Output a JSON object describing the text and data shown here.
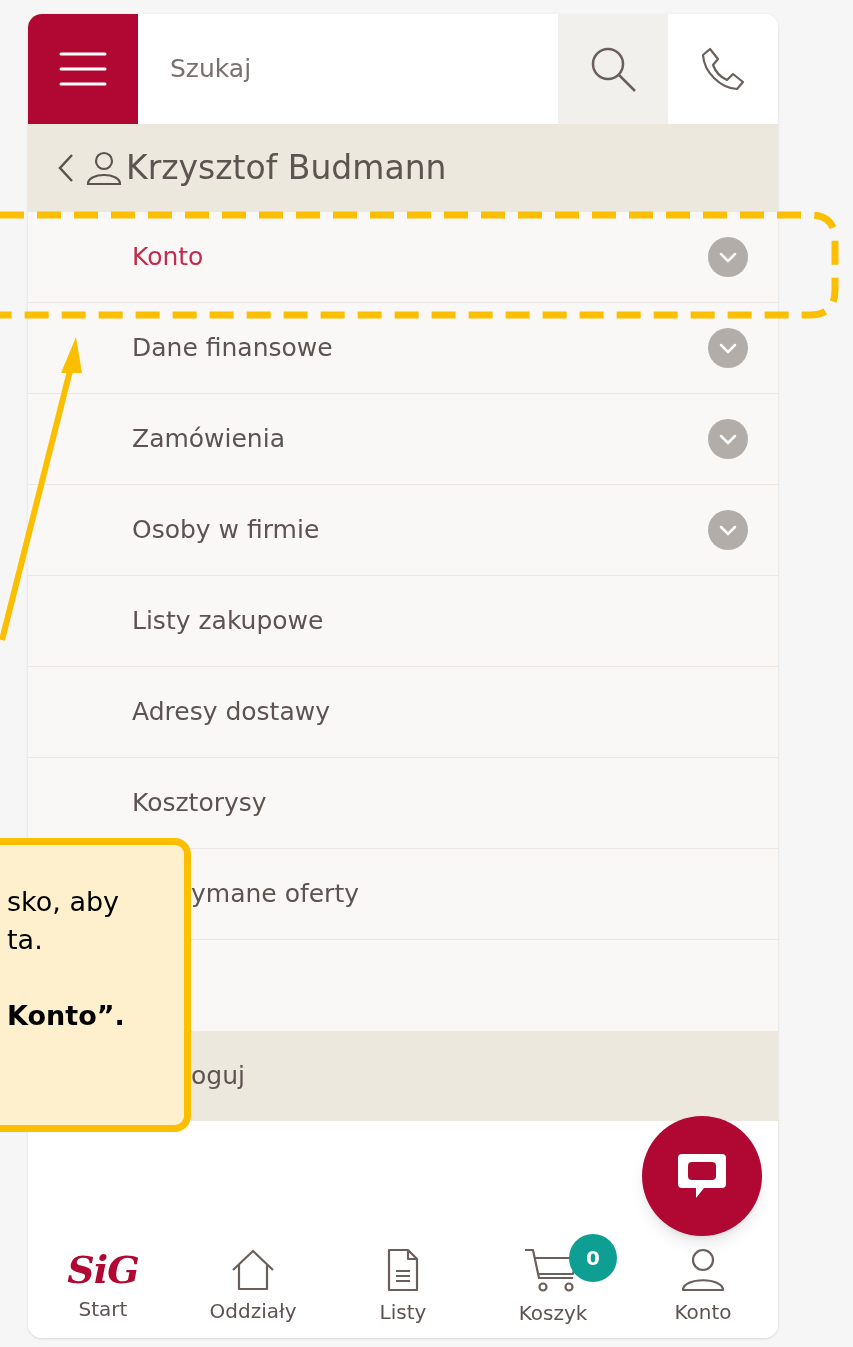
{
  "header": {
    "search": {
      "placeholder": "Szukaj"
    }
  },
  "profile": {
    "name": "Krzysztof Budmann"
  },
  "menu": [
    {
      "label": "Konto",
      "selected": true,
      "has_submenu": true,
      "clipped": false
    },
    {
      "label": "Dane finansowe",
      "selected": false,
      "has_submenu": true,
      "clipped": false
    },
    {
      "label": "Zamówienia",
      "selected": false,
      "has_submenu": true,
      "clipped": false
    },
    {
      "label": "Osoby w firmie",
      "selected": false,
      "has_submenu": true,
      "clipped": false
    },
    {
      "label": "Listy zakupowe",
      "selected": false,
      "has_submenu": false,
      "clipped": false
    },
    {
      "label": "Adresy dostawy",
      "selected": false,
      "has_submenu": false,
      "clipped": false
    },
    {
      "label": "Kosztorysy",
      "selected": false,
      "has_submenu": false,
      "clipped": false
    },
    {
      "label": "ymane oferty",
      "selected": false,
      "has_submenu": false,
      "clipped": true
    }
  ],
  "logout": {
    "label": "oguj"
  },
  "bottom_nav": [
    {
      "kind": "logo",
      "logo_text": "SiG",
      "label": "Start",
      "selected": false
    },
    {
      "kind": "home",
      "label": "Oddziały",
      "selected": false
    },
    {
      "kind": "lists",
      "label": "Listy",
      "selected": false
    },
    {
      "kind": "cart",
      "label": "Koszyk",
      "badge": "0",
      "selected": false
    },
    {
      "kind": "account",
      "label": "Konto",
      "selected": false
    }
  ],
  "callout": {
    "lines": [
      {
        "text": "sko, aby",
        "bold": false
      },
      {
        "text": "ta.",
        "bold": false
      },
      {
        "text": "Konto”.",
        "bold": true
      }
    ]
  }
}
